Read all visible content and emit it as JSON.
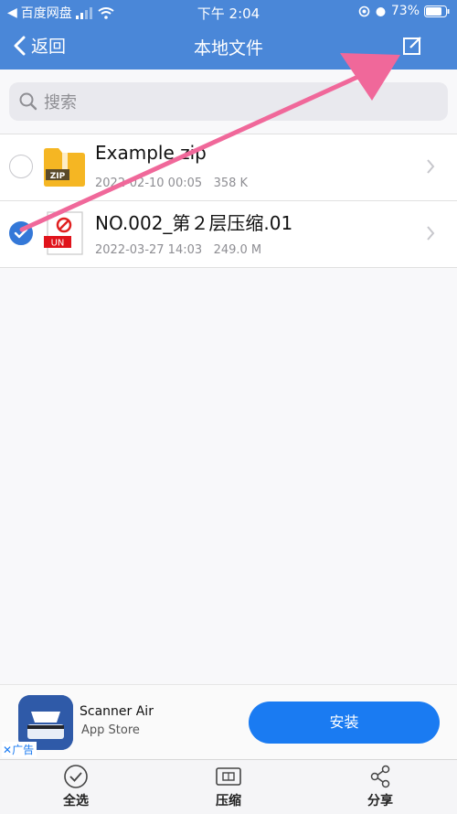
{
  "status_bar": {
    "back_app": "百度网盘",
    "time": "下午 2:04",
    "battery": "73%"
  },
  "nav": {
    "back_label": "返回",
    "title": "本地文件"
  },
  "search": {
    "placeholder": "搜索"
  },
  "files": [
    {
      "name": "Example.zip",
      "date": "2022-02-10 00:05",
      "size": "358 K",
      "icon_label": "ZIP",
      "selected": false
    },
    {
      "name": "NO.002_第２层压缩.01",
      "date": "2022-03-27 14:03",
      "size": "249.0 M",
      "icon_label": "UN",
      "selected": true
    }
  ],
  "ad": {
    "app_name": "Scanner Air",
    "store": "App Store",
    "install_label": "安装",
    "tag": "广告"
  },
  "tabbar": {
    "select_all": "全选",
    "compress": "压缩",
    "share": "分享"
  },
  "colors": {
    "nav_blue": "#4a87d8",
    "accent_blue": "#1a7bf2",
    "arrow_pink": "#f0689a"
  }
}
